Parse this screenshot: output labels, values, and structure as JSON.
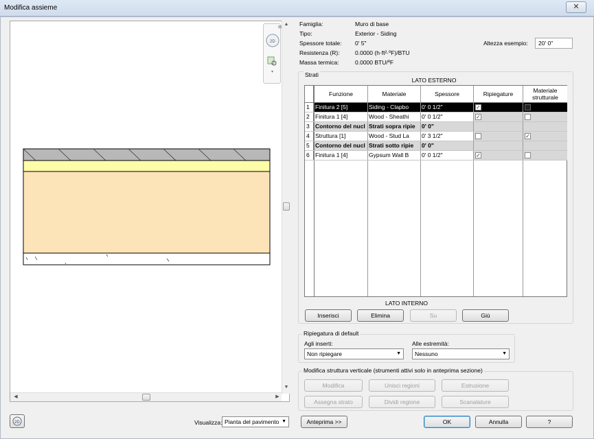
{
  "window": {
    "title": "Modifica assieme",
    "close_label": "✕"
  },
  "props": {
    "famiglia_label": "Famiglia:",
    "famiglia": "Muro di base",
    "tipo_label": "Tipo:",
    "tipo": "Exterior - Siding",
    "spessore_label": "Spessore totale:",
    "spessore": "0'  5\"",
    "resistenza_label": "Resistenza (R):",
    "resistenza": "0.0000 (h·ft²·ºF)/BTU",
    "massa_label": "Massa termica:",
    "massa": "0.0000 BTU/ºF",
    "altezza_label": "Altezza esempio:",
    "altezza": "20'  0\""
  },
  "strati": {
    "group_label": "Strati",
    "lato_esterno": "LATO ESTERNO",
    "lato_interno": "LATO INTERNO",
    "headers": [
      "Funzione",
      "Materiale",
      "Spessore",
      "Ripiegature",
      "Materiale strutturale"
    ],
    "rows": [
      {
        "num": "1",
        "funzione": "Finitura 2 [5]",
        "materiale": "Siding - Clapbo",
        "spessore": "0'  0 1/2\"",
        "rip": "✓",
        "str": ""
      },
      {
        "num": "2",
        "funzione": "Finitura 1 [4]",
        "materiale": "Wood - Sheathi",
        "spessore": "0'  0 1/2\"",
        "rip": "✓",
        "str": ""
      },
      {
        "num": "3",
        "funzione": "Contorno del nucl",
        "materiale": "Strati sopra ripie",
        "spessore": "0'  0\"",
        "rip": "",
        "str": ""
      },
      {
        "num": "4",
        "funzione": "Struttura [1]",
        "materiale": "Wood - Stud La",
        "spessore": "0'  3 1/2\"",
        "rip": "",
        "str": "✓"
      },
      {
        "num": "5",
        "funzione": "Contorno del nucl",
        "materiale": "Strati sotto ripie",
        "spessore": "0'  0\"",
        "rip": "",
        "str": ""
      },
      {
        "num": "6",
        "funzione": "Finitura 1 [4]",
        "materiale": "Gypsum Wall B",
        "spessore": "0'  0 1/2\"",
        "rip": "✓",
        "str": ""
      }
    ],
    "buttons": {
      "inserisci": "Inserisci",
      "elimina": "Elimina",
      "su": "Su",
      "giu": "Giù"
    }
  },
  "ripiegatura": {
    "group_label": "Ripiegatura di default",
    "inserti_label": "Agli inserti:",
    "inserti_value": "Non ripiegare",
    "estremita_label": "Alle estremità:",
    "estremita_value": "Nessuno"
  },
  "verticale": {
    "group_label": "Modifica struttura verticale (strumenti attivi solo in anteprima sezione)",
    "buttons": {
      "modifica": "Modifica",
      "unisci": "Unisci regioni",
      "estrusione": "Estrusione",
      "assegna": "Assegna strato",
      "dividi": "Dividi regione",
      "scanalature": "Scanalature"
    }
  },
  "footer": {
    "visualizza_label": "Visualizza:",
    "visualizza_value": "Pianta del pavimento",
    "anteprima": "Anteprima >>",
    "ok": "OK",
    "annulla": "Annulla",
    "help": "?"
  },
  "colors": {
    "siding": "#b8b8b8",
    "sheathing": "#fdfca8",
    "studs": "#fde4b8"
  }
}
